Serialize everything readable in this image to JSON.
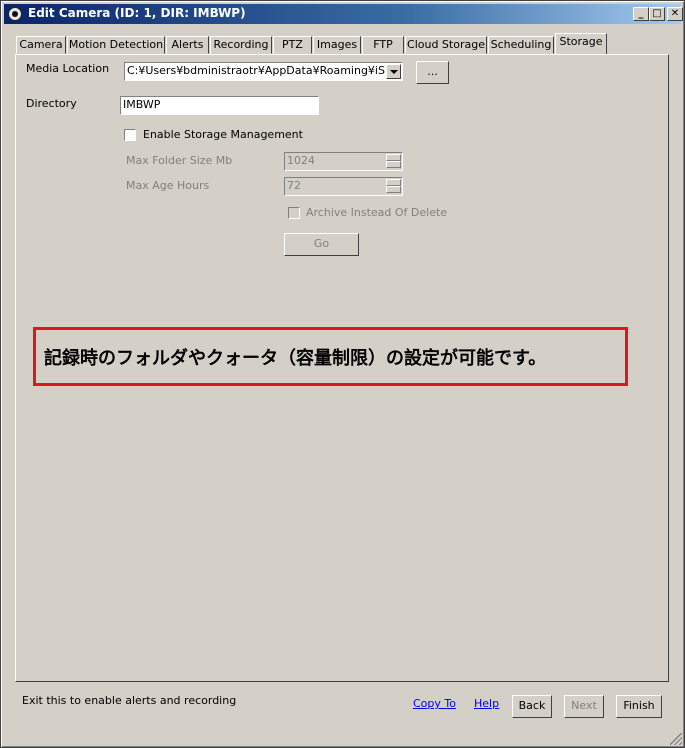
{
  "window": {
    "title": "Edit Camera (ID: 1, DIR: IMBWP)",
    "min_label": "_",
    "max_label": "□",
    "close_label": "✕"
  },
  "tabs": [
    {
      "label": "Camera",
      "active": false
    },
    {
      "label": "Motion Detection",
      "active": false
    },
    {
      "label": "Alerts",
      "active": false
    },
    {
      "label": "Recording",
      "active": false
    },
    {
      "label": "PTZ",
      "active": false
    },
    {
      "label": "Images",
      "active": false
    },
    {
      "label": "FTP",
      "active": false
    },
    {
      "label": "Cloud Storage",
      "active": false
    },
    {
      "label": "Scheduling",
      "active": false
    },
    {
      "label": "Storage",
      "active": true
    }
  ],
  "storage": {
    "media_location_label": "Media Location",
    "media_location_value": "C:¥Users¥bdministraotr¥AppData¥Roaming¥iSpy¥W",
    "browse_label": "...",
    "directory_label": "Directory",
    "directory_value": "IMBWP",
    "enable_storage_label": "Enable Storage Management",
    "enable_storage_checked": false,
    "max_folder_label": "Max Folder Size Mb",
    "max_folder_value": "1024",
    "max_age_label": "Max Age Hours",
    "max_age_value": "72",
    "archive_label": "Archive Instead Of Delete",
    "archive_checked": false,
    "go_label": "Go"
  },
  "annotation": {
    "text": "記録時のフォルダやクォータ（容量制限）の設定が可能です。",
    "border_color": "#e0161e"
  },
  "footer": {
    "status_text": "Exit this to enable alerts and recording",
    "copy_to_label": "Copy To",
    "help_label": "Help",
    "back_label": "Back",
    "next_label": "Next",
    "finish_label": "Finish"
  }
}
